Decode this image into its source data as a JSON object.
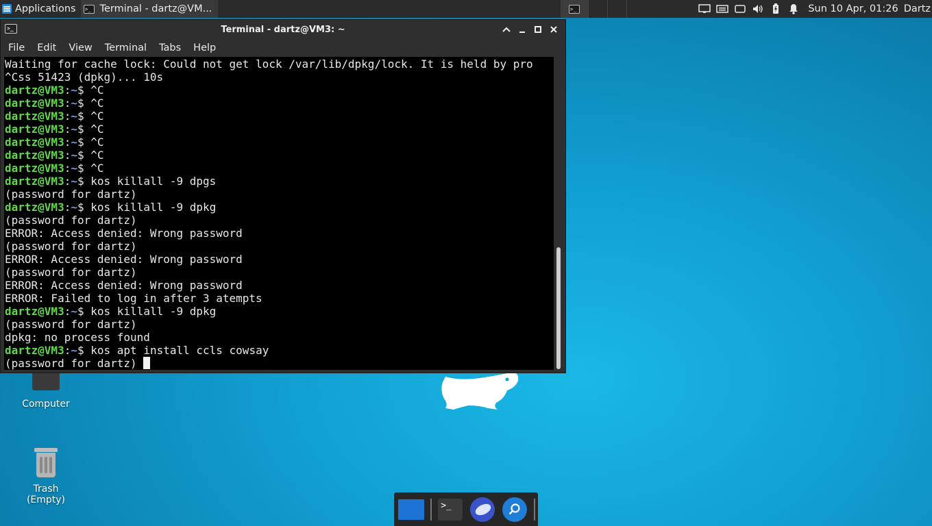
{
  "panel": {
    "applications_label": "Applications",
    "task_title": "Terminal - dartz@VM...",
    "clock": "Sun 10 Apr, 01:26",
    "user": "Dartz"
  },
  "window": {
    "title": "Terminal - dartz@VM3: ~",
    "menu": [
      "File",
      "Edit",
      "View",
      "Terminal",
      "Tabs",
      "Help"
    ]
  },
  "terminal": {
    "prompt_user": "dartz@VM3",
    "prompt_path": "~",
    "lines": [
      {
        "type": "out",
        "text": "Waiting for cache lock: Could not get lock /var/lib/dpkg/lock. It is held by pro"
      },
      {
        "type": "out",
        "text": "^Css 51423 (dpkg)... 10s"
      },
      {
        "type": "cmd",
        "text": "^C"
      },
      {
        "type": "cmd",
        "text": "^C"
      },
      {
        "type": "cmd",
        "text": "^C"
      },
      {
        "type": "cmd",
        "text": "^C"
      },
      {
        "type": "cmd",
        "text": "^C"
      },
      {
        "type": "cmd",
        "text": "^C"
      },
      {
        "type": "cmd",
        "text": "^C"
      },
      {
        "type": "cmd",
        "text": "kos killall -9 dpgs"
      },
      {
        "type": "out",
        "text": "(password for dartz)"
      },
      {
        "type": "cmd",
        "text": "kos killall -9 dpkg"
      },
      {
        "type": "out",
        "text": "(password for dartz)"
      },
      {
        "type": "out",
        "text": "ERROR: Access denied: Wrong password"
      },
      {
        "type": "out",
        "text": "(password for dartz)"
      },
      {
        "type": "out",
        "text": "ERROR: Access denied: Wrong password"
      },
      {
        "type": "out",
        "text": "(password for dartz)"
      },
      {
        "type": "out",
        "text": "ERROR: Access denied: Wrong password"
      },
      {
        "type": "out",
        "text": "ERROR: Failed to log in after 3 atempts"
      },
      {
        "type": "cmd",
        "text": "kos killall -9 dpkg"
      },
      {
        "type": "out",
        "text": "(password for dartz)"
      },
      {
        "type": "out",
        "text": "dpkg: no process found"
      },
      {
        "type": "cmd",
        "text": "kos apt install ccls cowsay"
      },
      {
        "type": "out",
        "text": "(password for dartz) ",
        "cursor": true
      }
    ]
  },
  "desktop": {
    "computer_label": "Computer",
    "trash_label": "Trash",
    "trash_status": "(Empty)"
  },
  "colors": {
    "prompt_user": "#5fd94a",
    "prompt_path": "#6f9ce0",
    "desktop": "#129fd2"
  }
}
